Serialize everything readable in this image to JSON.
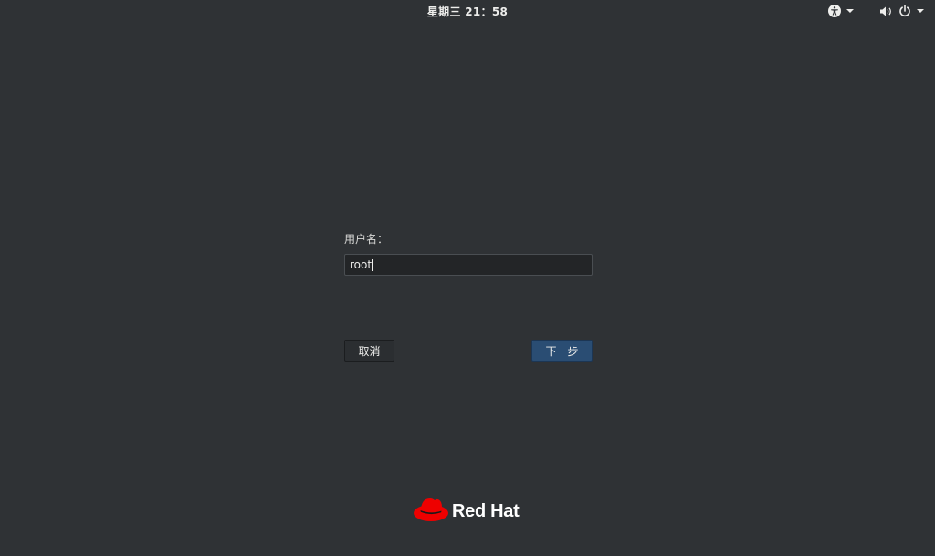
{
  "topbar": {
    "clock": "星期三 21：58",
    "accessibility_icon": "accessibility-icon",
    "volume_icon": "volume-icon",
    "power_icon": "power-icon"
  },
  "login": {
    "username_label": "用户名：",
    "username_value": "root",
    "cancel_label": "取消",
    "next_label": "下一步"
  },
  "branding": {
    "logo_text": "Red Hat",
    "logo_icon": "red-hat-fedora-icon",
    "brand_color": "#ee0000"
  },
  "colors": {
    "background": "#2f3235",
    "accent": "#2a4d73"
  }
}
